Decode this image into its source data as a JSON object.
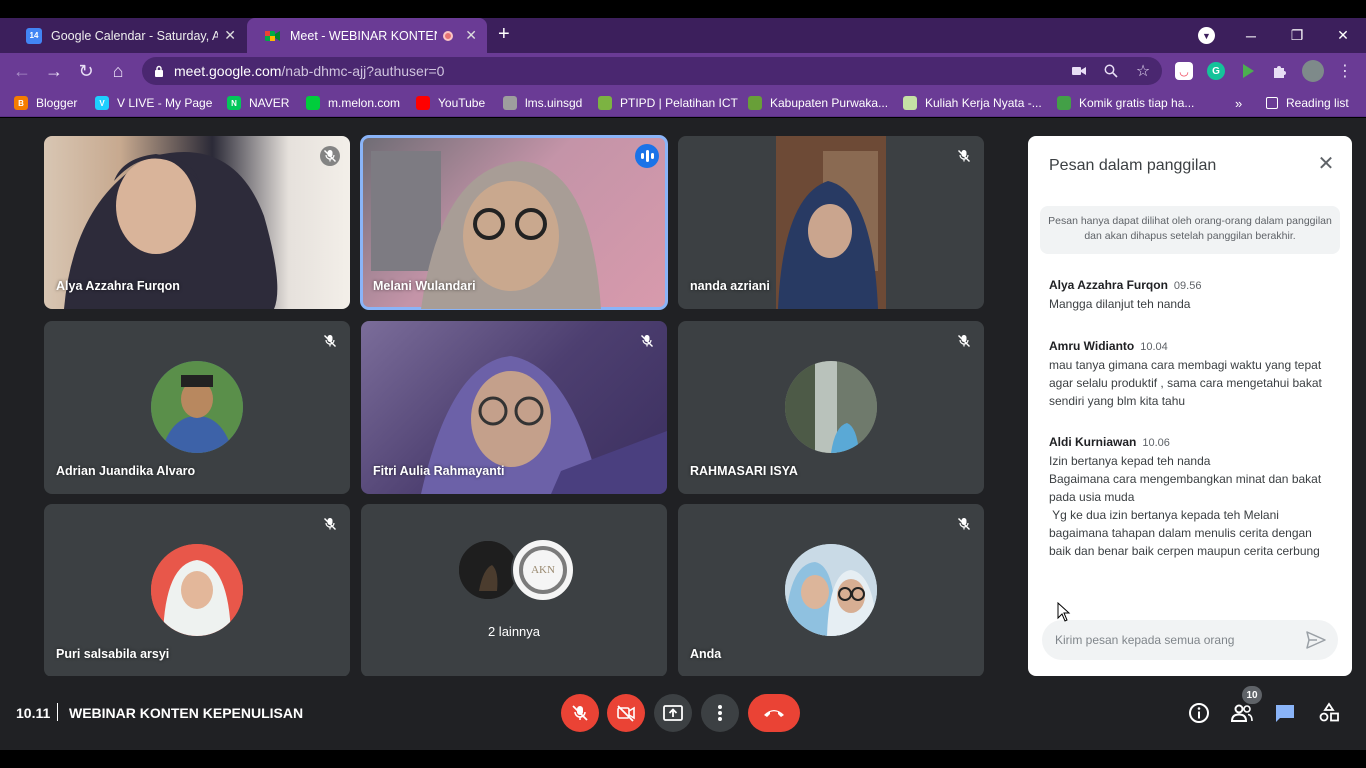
{
  "browser": {
    "tabs": [
      {
        "title": "Google Calendar - Saturday, Aug",
        "favicon": "calendar-icon",
        "favicon_text": "14",
        "active": false
      },
      {
        "title": "Meet - WEBINAR KONTEN KEPENULISAN",
        "favicon": "meet-icon",
        "active": true,
        "recording": true
      }
    ],
    "address": {
      "domain": "meet.google.com",
      "path": "/nab-dhmc-ajj?authuser=0"
    },
    "bookmarks": [
      {
        "label": "Blogger",
        "icon": "blogger-icon",
        "icon_text": "B",
        "color": "#f57c00"
      },
      {
        "label": "V LIVE - My Page",
        "icon": "vlive-icon",
        "icon_text": "V",
        "color": "#1ecfff"
      },
      {
        "label": "NAVER",
        "icon": "naver-icon",
        "icon_text": "N",
        "color": "#03c75a"
      },
      {
        "label": "m.melon.com",
        "icon": "melon-icon",
        "icon_text": "",
        "color": "#00cd3c"
      },
      {
        "label": "YouTube",
        "icon": "youtube-icon",
        "icon_text": "",
        "color": "#ff0000"
      },
      {
        "label": "lms.uinsgd",
        "icon": "page-icon",
        "icon_text": "",
        "color": "#9e9e9e"
      },
      {
        "label": "PTIPD | Pelatihan ICT",
        "icon": "ptipd-icon",
        "icon_text": "",
        "color": "#7cb342"
      },
      {
        "label": "Kabupaten Purwaka...",
        "icon": "emblem-icon",
        "icon_text": "",
        "color": "#689f38"
      },
      {
        "label": "Kuliah Kerja Nyata -...",
        "icon": "kkn-icon",
        "icon_text": "",
        "color": "#c5e1a5"
      },
      {
        "label": "Komik gratis tiap ha...",
        "icon": "comic-icon",
        "icon_text": "",
        "color": "#43a047"
      }
    ],
    "reading_list": "Reading list",
    "more_bookmarks": "»"
  },
  "tiles": [
    {
      "name": "Alya Azzahra Furqon",
      "muted": true,
      "type": "video",
      "bg": "#c9b8a8"
    },
    {
      "name": "Melani Wulandari",
      "muted": false,
      "speaking": true,
      "type": "video",
      "bg": "#b07a8f"
    },
    {
      "name": "nanda azriani",
      "muted": true,
      "type": "video-narrow",
      "bg": "#6d4a36"
    },
    {
      "name": "Adrian Juandika Alvaro",
      "muted": true,
      "type": "avatar",
      "bg": "#5f7fb0"
    },
    {
      "name": "Fitri Aulia Rahmayanti",
      "muted": true,
      "type": "video",
      "bg": "#4a3d6e"
    },
    {
      "name": "RAHMASARI ISYA",
      "muted": true,
      "type": "avatar",
      "bg": "#7a8079"
    },
    {
      "name": "Puri salsabila arsyi",
      "muted": true,
      "type": "avatar",
      "bg": "#e85c4a"
    },
    {
      "name": "2 lainnya",
      "muted": false,
      "type": "group"
    },
    {
      "name": "Anda",
      "muted": true,
      "type": "avatar",
      "bg": "#b5cfe0"
    }
  ],
  "group_avatar_text": "AKN",
  "chat": {
    "title": "Pesan dalam panggilan",
    "notice": "Pesan hanya dapat dilihat oleh orang-orang dalam panggilan dan akan dihapus setelah panggilan berakhir.",
    "messages": [
      {
        "sender": "Alya Azzahra Furqon",
        "time": "09.56",
        "lines": [
          "Mangga dilanjut teh nanda"
        ]
      },
      {
        "sender": "Amru Widianto",
        "time": "10.04",
        "lines": [
          "mau tanya gimana cara membagi waktu yang tepat",
          "agar selalu produktif , sama cara mengetahui bakat",
          "sendiri yang blm kita tahu"
        ]
      },
      {
        "sender": "Aldi Kurniawan",
        "time": "10.06",
        "lines": [
          "Izin bertanya kepad teh nanda",
          "Bagaimana cara mengembangkan minat dan bakat",
          "pada usia muda",
          " Yg ke dua izin bertanya kepada teh Melani",
          "bagaimana tahapan dalam menulis cerita dengan",
          "baik dan benar baik cerpen maupun cerita cerbung"
        ]
      }
    ],
    "input_placeholder": "Kirim pesan kepada semua orang"
  },
  "bottom": {
    "time": "10.11",
    "meeting_title": "WEBINAR KONTEN KEPENULISAN",
    "participants_count": "10"
  },
  "colors": {
    "end_call": "#ea4335",
    "accent": "#1a73e8",
    "chrome_purple": "#6a3b95"
  }
}
